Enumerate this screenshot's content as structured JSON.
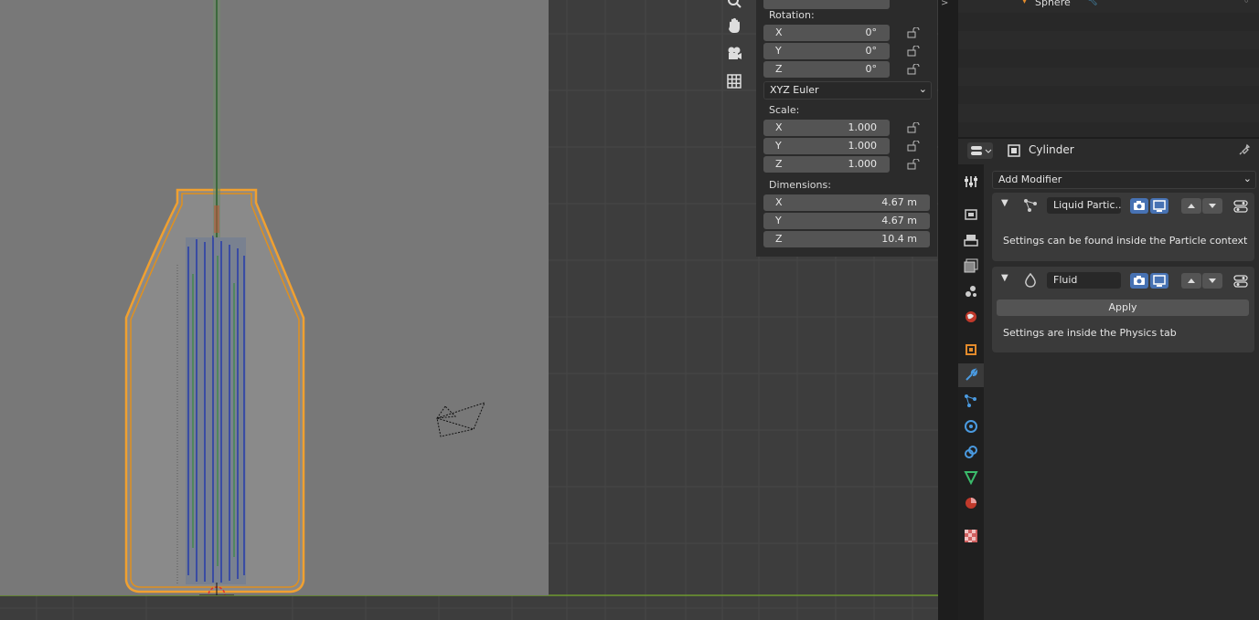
{
  "n_panel": {
    "rotation_label": "Rotation:",
    "rotation": [
      {
        "axis": "X",
        "value": "0°"
      },
      {
        "axis": "Y",
        "value": "0°"
      },
      {
        "axis": "Z",
        "value": "0°"
      }
    ],
    "rotation_mode": "XYZ Euler",
    "scale_label": "Scale:",
    "scale": [
      {
        "axis": "X",
        "value": "1.000"
      },
      {
        "axis": "Y",
        "value": "1.000"
      },
      {
        "axis": "Z",
        "value": "1.000"
      }
    ],
    "dimensions_label": "Dimensions:",
    "dimensions": [
      {
        "axis": "X",
        "value": "4.67 m"
      },
      {
        "axis": "Y",
        "value": "4.67 m"
      },
      {
        "axis": "Z",
        "value": "10.4 m"
      }
    ]
  },
  "outliner": {
    "visible_item": "Sphere"
  },
  "properties": {
    "object_name": "Cylinder",
    "add_modifier": "Add Modifier",
    "modifiers": [
      {
        "name": "Liquid Partic..",
        "info": "Settings can be found inside the Particle context"
      },
      {
        "name": "Fluid",
        "apply_label": "Apply",
        "info": "Settings are inside the Physics tab"
      }
    ]
  },
  "colors": {
    "accent_blue": "#4772b3",
    "selection_orange": "#f0a030",
    "viewport_bg": "#3d3d3d",
    "camera_bg": "#787878"
  }
}
